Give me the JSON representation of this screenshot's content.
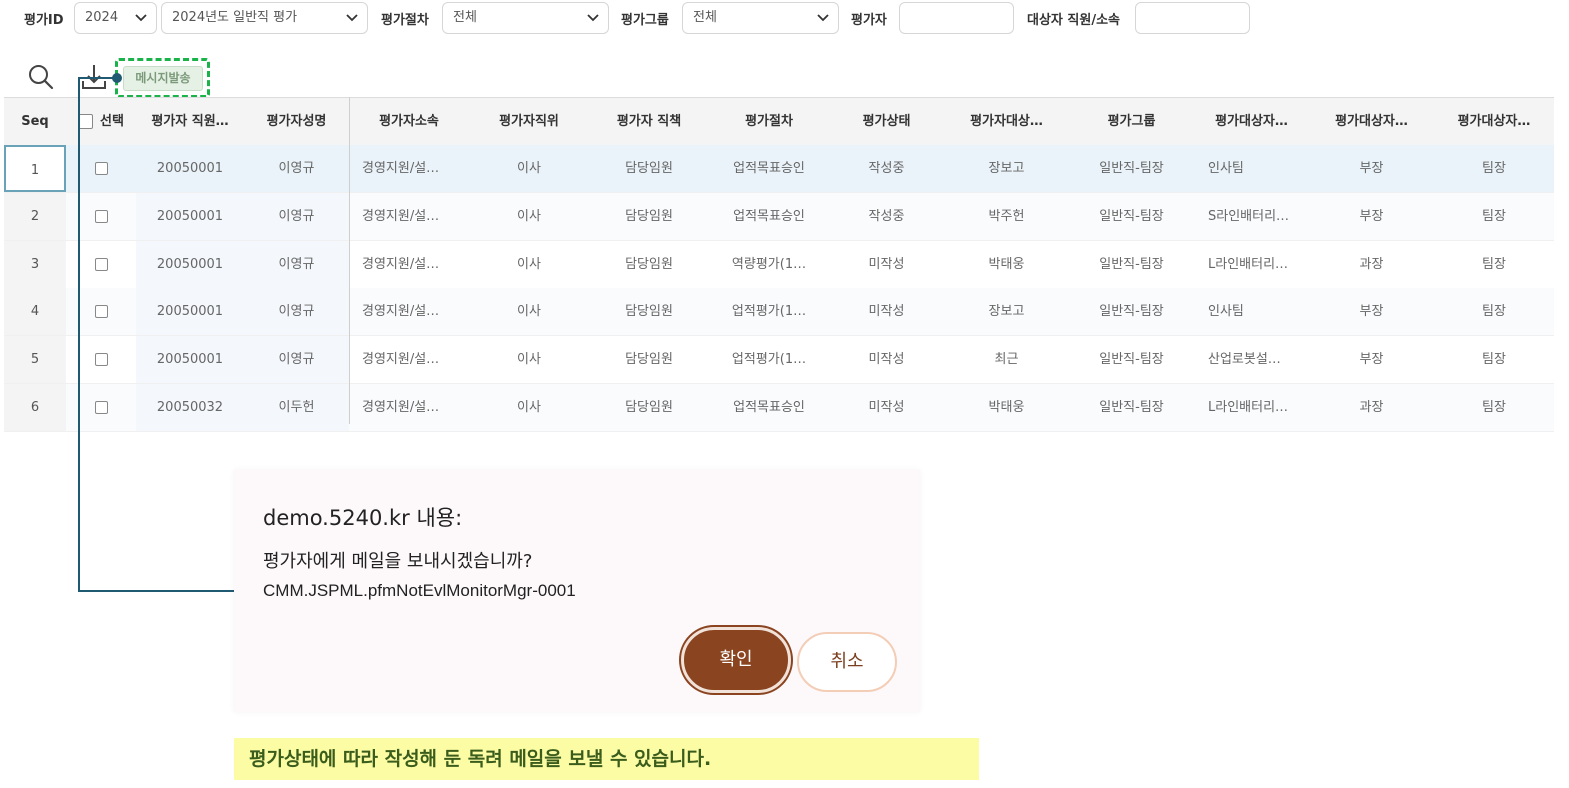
{
  "filters": {
    "eval_id_label": "평가ID",
    "year_value": "2024",
    "eval_name_value": "2024년도 일반직 평가",
    "procedure_label": "평가절차",
    "procedure_value": "전체",
    "group_label": "평가그룹",
    "group_value": "전체",
    "evaluator_label": "평가자",
    "evaluator_value": "",
    "target_label": "대상자 직원/소속",
    "target_value": ""
  },
  "toolbar": {
    "search_icon": "search-icon",
    "download_icon": "download-icon",
    "send_message_label": "메시지발송"
  },
  "grid": {
    "columns": [
      "Seq",
      "선택",
      "평가자 직원…",
      "평가자성명",
      "평가자소속",
      "평가자직위",
      "평가자 직책",
      "평가절차",
      "평가상태",
      "평가자대상…",
      "평가그룹",
      "평가대상자…",
      "평가대상자…",
      "평가대상자…"
    ],
    "rows": [
      [
        "1",
        "",
        "20050001",
        "이영규",
        "경영지원/설…",
        "이사",
        "담당임원",
        "업적목표승인",
        "작성중",
        "장보고",
        "일반직-팀장",
        "인사팀",
        "부장",
        "팀장"
      ],
      [
        "2",
        "",
        "20050001",
        "이영규",
        "경영지원/설…",
        "이사",
        "담당임원",
        "업적목표승인",
        "작성중",
        "박주헌",
        "일반직-팀장",
        "S라인배터리…",
        "부장",
        "팀장"
      ],
      [
        "3",
        "",
        "20050001",
        "이영규",
        "경영지원/설…",
        "이사",
        "담당임원",
        "역량평가(1…",
        "미작성",
        "박태웅",
        "일반직-팀장",
        "L라인배터리…",
        "과장",
        "팀장"
      ],
      [
        "4",
        "",
        "20050001",
        "이영규",
        "경영지원/설…",
        "이사",
        "담당임원",
        "업적평가(1…",
        "미작성",
        "장보고",
        "일반직-팀장",
        "인사팀",
        "부장",
        "팀장"
      ],
      [
        "5",
        "",
        "20050001",
        "이영규",
        "경영지원/설…",
        "이사",
        "담당임원",
        "업적평가(1…",
        "미작성",
        "최근",
        "일반직-팀장",
        "산업로봇설…",
        "부장",
        "팀장"
      ],
      [
        "6",
        "",
        "20050032",
        "이두헌",
        "경영지원/설…",
        "이사",
        "담당임원",
        "업적목표승인",
        "미작성",
        "박태웅",
        "일반직-팀장",
        "L라인배터리…",
        "과장",
        "팀장"
      ]
    ]
  },
  "dialog": {
    "title": "demo.5240.kr 내용:",
    "message": "평가자에게 메일을 보내시겠습니까?",
    "code": "CMM.JSPML.pfmNotEvlMonitorMgr-0001",
    "ok_label": "확인",
    "cancel_label": "취소"
  },
  "annotation": {
    "note": "평가상태에 따라 작성해 둔 독려 메일을 보낼 수 있습니다.",
    "highlight_color": "#19b34a",
    "connector_color": "#1f5a72",
    "note_bg": "#fcfca4"
  }
}
